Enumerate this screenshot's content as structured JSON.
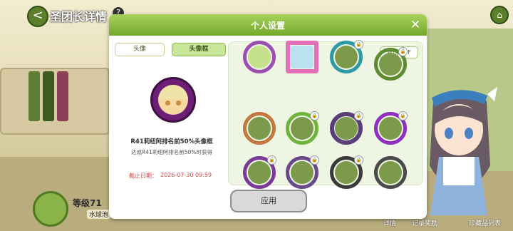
{
  "page": {
    "title": "圣团长详情",
    "help_glyph": "?",
    "back_glyph": "<",
    "home_glyph": "⌂"
  },
  "level": {
    "label": "等级71",
    "sub_label": "水球泡"
  },
  "bottom_bar": {
    "details": "详情",
    "records": "记录奖励",
    "collection": "珍藏品列表"
  },
  "dialog": {
    "title": "个人设置",
    "close_glyph": "✕",
    "tabs": [
      {
        "label": "头像"
      },
      {
        "label": "头像框"
      }
    ],
    "filter_label": "筛选 OFF",
    "selected_item": {
      "name": "R41莉纽阿排名前50%头像框",
      "description": "达成R41莉纽阿排名前50%时获得",
      "deadline_label": "截止日期：",
      "deadline_value": "2026-07-30 09:59"
    },
    "apply_label": "应用",
    "lock_glyph": "🔒",
    "colors": {
      "header_start": "#a6d35a",
      "header_end": "#74a92c",
      "deadline": "#d34b4b",
      "filter_border": "#a5c77a"
    }
  },
  "frames": [
    {
      "name": "frame-purple",
      "locked": false
    },
    {
      "name": "frame-pixel-rainbow",
      "locked": false
    },
    {
      "name": "frame-teal",
      "locked": true
    },
    {
      "name": "frame-green-plant",
      "locked": true
    },
    {
      "name": "frame-shiba",
      "locked": false
    },
    {
      "name": "frame-green-leaf",
      "locked": true
    },
    {
      "name": "frame-purple-mech",
      "locked": true
    },
    {
      "name": "frame-purple-glow",
      "locked": true
    },
    {
      "name": "frame-purple-simple",
      "locked": true
    },
    {
      "name": "frame-slime",
      "locked": true
    },
    {
      "name": "frame-dark",
      "locked": true
    },
    {
      "name": "frame-dark-gray",
      "locked": false
    }
  ]
}
